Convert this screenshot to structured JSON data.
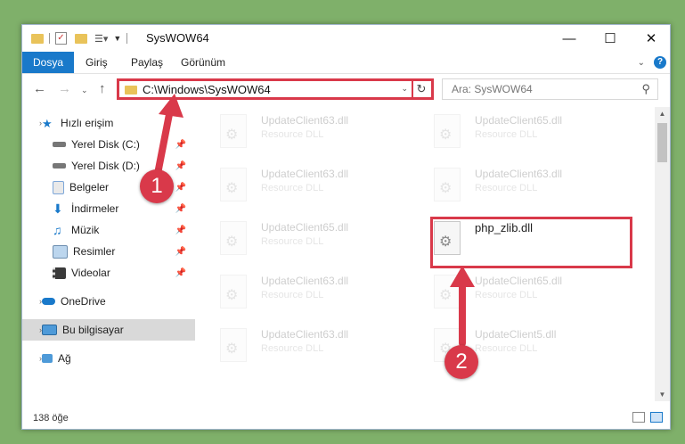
{
  "window": {
    "title": "SysWOW64"
  },
  "ribbon": {
    "tabs": [
      "Dosya",
      "Giriş",
      "Paylaş",
      "Görünüm"
    ]
  },
  "nav": {
    "address": "C:\\Windows\\SysWOW64",
    "search_placeholder": "Ara: SysWOW64"
  },
  "sidebar": {
    "items": [
      {
        "label": "Hızlı erişim",
        "icon": "star-icon"
      },
      {
        "label": "Yerel Disk (C:)",
        "icon": "drive-icon",
        "pinned": true
      },
      {
        "label": "Yerel Disk (D:)",
        "icon": "drive-icon",
        "pinned": true
      },
      {
        "label": "Belgeler",
        "icon": "documents-icon",
        "pinned": true
      },
      {
        "label": "İndirmeler",
        "icon": "download-icon",
        "pinned": true
      },
      {
        "label": "Müzik",
        "icon": "music-icon",
        "pinned": true
      },
      {
        "label": "Resimler",
        "icon": "pictures-icon",
        "pinned": true
      },
      {
        "label": "Videolar",
        "icon": "videos-icon",
        "pinned": true
      },
      {
        "label": "OneDrive",
        "icon": "cloud-icon"
      },
      {
        "label": "Bu bilgisayar",
        "icon": "computer-icon",
        "selected": true
      },
      {
        "label": "Ağ",
        "icon": "network-icon"
      }
    ]
  },
  "files": [
    {
      "name": "UpdateClient63.dll",
      "desc": "Resource DLL"
    },
    {
      "name": "UpdateClient65.dll",
      "desc": "Resource DLL"
    },
    {
      "name": "UpdateClient63.dll",
      "desc": "Resource DLL"
    },
    {
      "name": "UpdateClient63.dll",
      "desc": "Resource DLL"
    },
    {
      "name": "UpdateClient65.dll",
      "desc": "Resource DLL"
    },
    {
      "name": "php_zlib.dll",
      "desc": ""
    },
    {
      "name": "UpdateClient63.dll",
      "desc": "Resource DLL"
    },
    {
      "name": "UpdateClient65.dll",
      "desc": "Resource DLL"
    },
    {
      "name": "UpdateClient63.dll",
      "desc": "Resource DLL"
    },
    {
      "name": "UpdateClient5.dll",
      "desc": "Resource DLL"
    }
  ],
  "status": {
    "item_count": "138 öğe"
  },
  "annotations": {
    "step1": "1",
    "step2": "2"
  },
  "colors": {
    "accent": "#1979ca",
    "highlight": "#d9394a"
  }
}
